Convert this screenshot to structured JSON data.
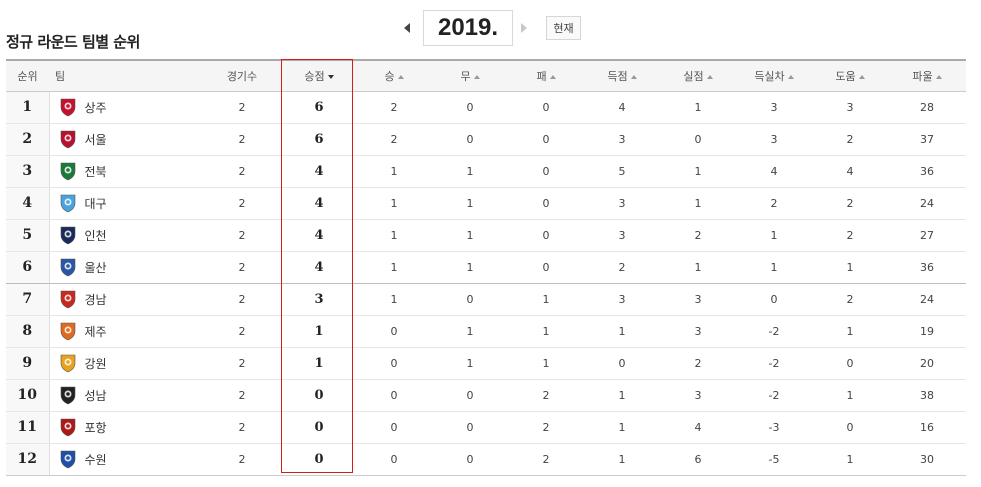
{
  "page_title": "정규 라운드 팀별 순위",
  "year": "2019.",
  "now_button": "현재",
  "columns": {
    "rank": "순위",
    "team": "팀",
    "games": "경기수",
    "points": "승점",
    "win": "승",
    "draw": "무",
    "loss": "패",
    "goals_for": "득점",
    "goals_against": "실점",
    "goal_diff": "득실차",
    "assists": "도움",
    "fouls": "파울"
  },
  "sort_column": "points",
  "rows": [
    {
      "rank": "1",
      "team": "상주",
      "games": "2",
      "points": "6",
      "win": "2",
      "draw": "0",
      "loss": "0",
      "gf": "4",
      "ga": "1",
      "gd": "3",
      "ast": "3",
      "foul": "28",
      "icon": "sangju-emblem-icon",
      "color": "#c8102e"
    },
    {
      "rank": "2",
      "team": "서울",
      "games": "2",
      "points": "6",
      "win": "2",
      "draw": "0",
      "loss": "0",
      "gf": "3",
      "ga": "0",
      "gd": "3",
      "ast": "2",
      "foul": "37",
      "icon": "seoul-emblem-icon",
      "color": "#b8102e"
    },
    {
      "rank": "3",
      "team": "전북",
      "games": "2",
      "points": "4",
      "win": "1",
      "draw": "1",
      "loss": "0",
      "gf": "5",
      "ga": "1",
      "gd": "4",
      "ast": "4",
      "foul": "36",
      "icon": "jeonbuk-emblem-icon",
      "color": "#1b7a3a"
    },
    {
      "rank": "4",
      "team": "대구",
      "games": "2",
      "points": "4",
      "win": "1",
      "draw": "1",
      "loss": "0",
      "gf": "3",
      "ga": "1",
      "gd": "2",
      "ast": "2",
      "foul": "24",
      "icon": "daegu-emblem-icon",
      "color": "#4aa3df"
    },
    {
      "rank": "5",
      "team": "인천",
      "games": "2",
      "points": "4",
      "win": "1",
      "draw": "1",
      "loss": "0",
      "gf": "3",
      "ga": "2",
      "gd": "1",
      "ast": "2",
      "foul": "27",
      "icon": "incheon-emblem-icon",
      "color": "#1a2a5a"
    },
    {
      "rank": "6",
      "team": "울산",
      "games": "2",
      "points": "4",
      "win": "1",
      "draw": "1",
      "loss": "0",
      "gf": "2",
      "ga": "1",
      "gd": "1",
      "ast": "1",
      "foul": "36",
      "icon": "ulsan-emblem-icon",
      "color": "#2a56a8"
    },
    {
      "rank": "7",
      "team": "경남",
      "games": "2",
      "points": "3",
      "win": "1",
      "draw": "0",
      "loss": "1",
      "gf": "3",
      "ga": "3",
      "gd": "0",
      "ast": "2",
      "foul": "24",
      "icon": "gyeongnam-emblem-icon",
      "color": "#c8281e"
    },
    {
      "rank": "8",
      "team": "제주",
      "games": "2",
      "points": "1",
      "win": "0",
      "draw": "1",
      "loss": "1",
      "gf": "1",
      "ga": "3",
      "gd": "-2",
      "ast": "1",
      "foul": "19",
      "icon": "jeju-emblem-icon",
      "color": "#e06a1e"
    },
    {
      "rank": "9",
      "team": "강원",
      "games": "2",
      "points": "1",
      "win": "0",
      "draw": "1",
      "loss": "1",
      "gf": "0",
      "ga": "2",
      "gd": "-2",
      "ast": "0",
      "foul": "20",
      "icon": "gangwon-emblem-icon",
      "color": "#e8a21e"
    },
    {
      "rank": "10",
      "team": "성남",
      "games": "2",
      "points": "0",
      "win": "0",
      "draw": "0",
      "loss": "2",
      "gf": "1",
      "ga": "3",
      "gd": "-2",
      "ast": "1",
      "foul": "38",
      "icon": "seongnam-emblem-icon",
      "color": "#222222"
    },
    {
      "rank": "11",
      "team": "포항",
      "games": "2",
      "points": "0",
      "win": "0",
      "draw": "0",
      "loss": "2",
      "gf": "1",
      "ga": "4",
      "gd": "-3",
      "ast": "0",
      "foul": "16",
      "icon": "pohang-emblem-icon",
      "color": "#b01818"
    },
    {
      "rank": "12",
      "team": "수원",
      "games": "2",
      "points": "0",
      "win": "0",
      "draw": "0",
      "loss": "2",
      "gf": "1",
      "ga": "6",
      "gd": "-5",
      "ast": "1",
      "foul": "30",
      "icon": "suwon-emblem-icon",
      "color": "#1f4fa8"
    }
  ]
}
